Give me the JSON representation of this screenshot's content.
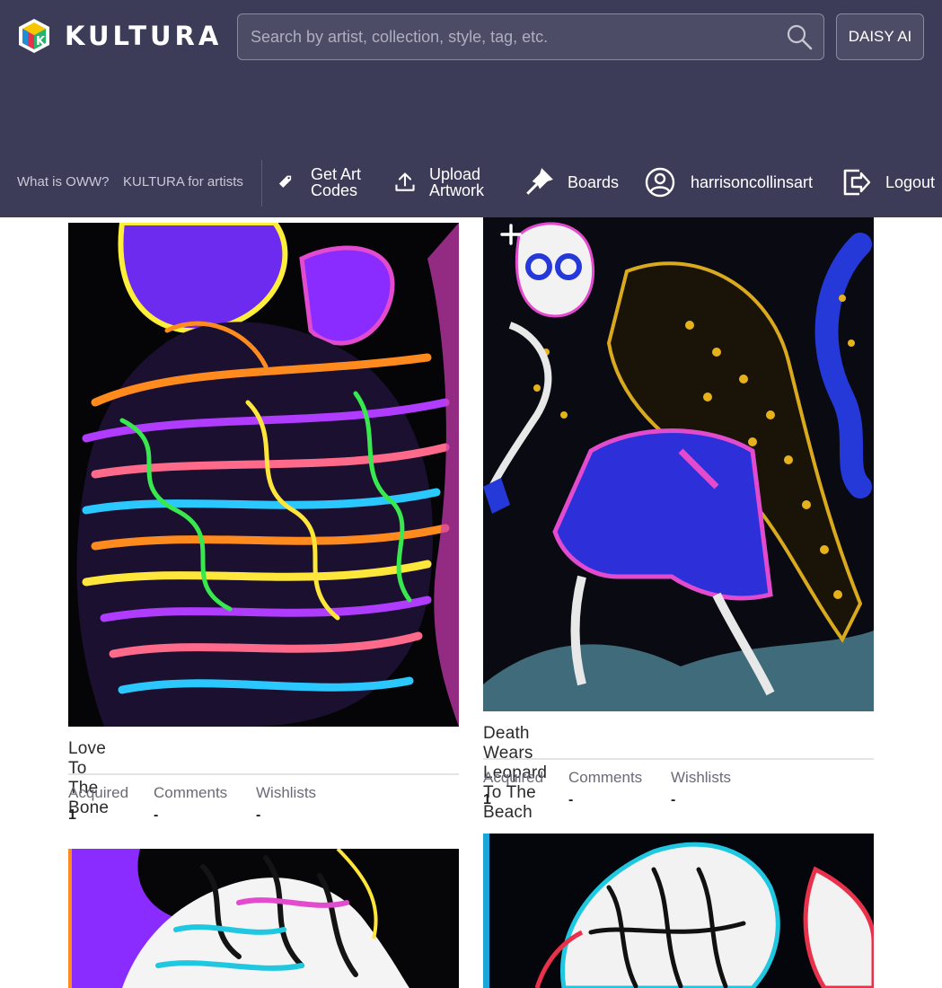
{
  "app": {
    "brand": "KULTURA"
  },
  "search": {
    "placeholder": "Search by artist, collection, style, tag, etc."
  },
  "daisy_button": {
    "label": "DAISY AI"
  },
  "nav": {
    "what_is": "What is OWW?",
    "for_artists": "KULTURA for artists",
    "get_codes_line1": "Get Art",
    "get_codes_line2": "Codes",
    "upload_line1": "Upload",
    "upload_line2": "Artwork",
    "boards": "Boards",
    "username": "harrisoncollinsart",
    "logout": "Logout"
  },
  "stats_labels": {
    "acquired": "Acquired",
    "comments": "Comments",
    "wishlists": "Wishlists"
  },
  "artworks": [
    {
      "title": "Love To The Bone",
      "acquired": "1",
      "comments": "-",
      "wishlists": "-"
    },
    {
      "title": "Death Wears Leopard To The Beach",
      "acquired": "1",
      "comments": "-",
      "wishlists": "-"
    }
  ],
  "icons": {
    "logo": "kultura-cube-icon",
    "search": "search-icon",
    "codes": "tag-icon",
    "upload": "upload-icon",
    "boards": "pin-icon",
    "user": "user-circle-icon",
    "logout": "logout-icon",
    "add": "plus-icon"
  },
  "colors": {
    "header_bg": "#3c3b58",
    "text_muted": "#6a6a78",
    "rule": "#e4e4e8"
  }
}
